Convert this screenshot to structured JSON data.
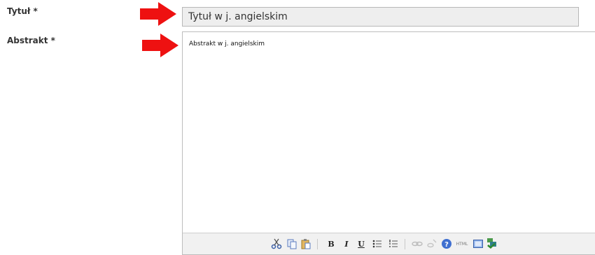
{
  "form": {
    "title_label": "Tytuł *",
    "title_value": "Tytuł w j. angielskim",
    "abstract_label": "Abstrakt *",
    "abstract_value": "Abstrakt w j. angielskim"
  },
  "annotation": {
    "arrow_color": "#ee1111"
  },
  "toolbar": {
    "buttons": [
      "cut-icon",
      "copy-icon",
      "paste-icon",
      "bold-button",
      "italic-button",
      "underline-button",
      "bullet-list-icon",
      "numbered-list-icon",
      "link-icon",
      "unlink-icon",
      "help-icon",
      "html-source-icon",
      "fullscreen-icon",
      "spellcheck-icon"
    ],
    "bold_label": "B",
    "italic_label": "I",
    "underline_label": "U",
    "html_label": "HTML"
  }
}
